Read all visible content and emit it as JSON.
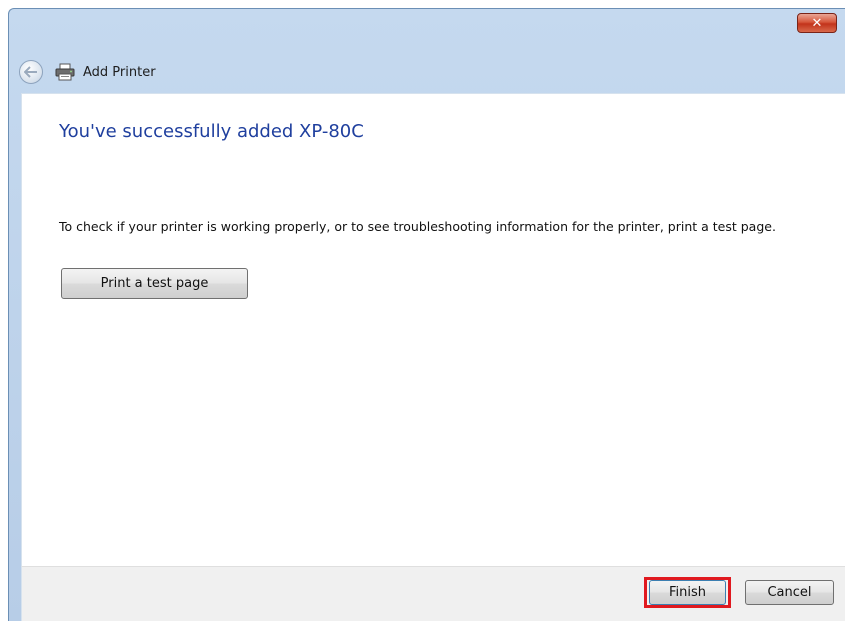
{
  "window": {
    "title": "Add Printer",
    "close_glyph": "✕"
  },
  "icons": {
    "back": "back-arrow-icon",
    "printer": "printer-icon",
    "close": "close-icon"
  },
  "main": {
    "heading": "You've successfully added XP-80C",
    "instruction": "To check if your printer is working properly, or to see troubleshooting information for the printer, print a test page.",
    "test_page_label": "Print a test page"
  },
  "footer": {
    "finish_label": "Finish",
    "cancel_label": "Cancel"
  },
  "colors": {
    "heading": "#1f3f9e",
    "highlight": "#e0191f",
    "close_button": "#c2331a"
  }
}
